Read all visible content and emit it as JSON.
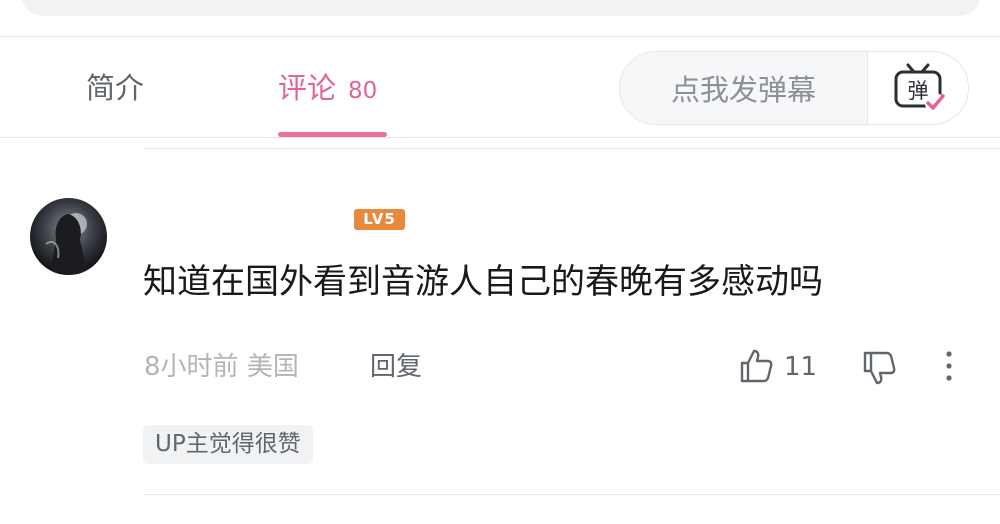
{
  "tabs": {
    "intro_label": "简介",
    "comments_label": "评论",
    "comments_count": "80"
  },
  "danmaku": {
    "input_placeholder": "点我发弹幕",
    "toggle_icon": "danmaku-toggle-icon",
    "toggle_glyph": "弹"
  },
  "comment": {
    "avatar_icon": "user-avatar",
    "level": "LV5",
    "text": "知道在国外看到音游人自己的春晚有多感动吗",
    "time": "8小时前",
    "location": "美国",
    "reply_label": "回复",
    "like_count": "11",
    "up_tag": "UP主觉得很赞"
  },
  "colors": {
    "accent": "#e0659a",
    "level_badge": "#e88a3e"
  }
}
